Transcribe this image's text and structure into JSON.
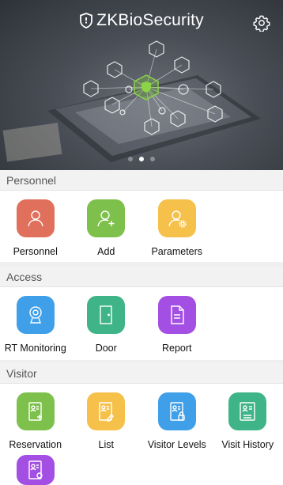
{
  "header": {
    "brand": "ZKBioSecurity",
    "settings_icon": "gear-icon",
    "carousel_pages": 3,
    "carousel_active": 2
  },
  "colors": {
    "red": "#e0705b",
    "green": "#7dc04b",
    "yellow": "#f6c14b",
    "blue": "#3f9fe8",
    "teal": "#3fb488",
    "purple": "#a34fe3",
    "section_bg": "#f2f2f2"
  },
  "sections": {
    "personnel": {
      "title": "Personnel",
      "items": [
        {
          "label": "Personnel",
          "icon": "person-icon",
          "color": "#e0705b"
        },
        {
          "label": "Add",
          "icon": "person-add-icon",
          "color": "#7dc04b"
        },
        {
          "label": "Parameters",
          "icon": "person-settings-icon",
          "color": "#f6c14b"
        }
      ]
    },
    "access": {
      "title": "Access",
      "items": [
        {
          "label": "RT Monitoring",
          "icon": "webcam-icon",
          "color": "#3f9fe8"
        },
        {
          "label": "Door",
          "icon": "door-icon",
          "color": "#3fb488"
        },
        {
          "label": "Report",
          "icon": "report-icon",
          "color": "#a34fe3"
        }
      ]
    },
    "visitor": {
      "title": "Visitor",
      "items": [
        {
          "label": "Reservation",
          "icon": "badge-add-icon",
          "color": "#7dc04b"
        },
        {
          "label": "List",
          "icon": "badge-edit-icon",
          "color": "#f6c14b"
        },
        {
          "label": "Visitor Levels",
          "icon": "badge-lock-icon",
          "color": "#3f9fe8"
        },
        {
          "label": "Visit History",
          "icon": "badge-history-icon",
          "color": "#3fb488"
        },
        {
          "label": "",
          "icon": "badge-settings-icon",
          "color": "#a34fe3"
        }
      ]
    }
  }
}
